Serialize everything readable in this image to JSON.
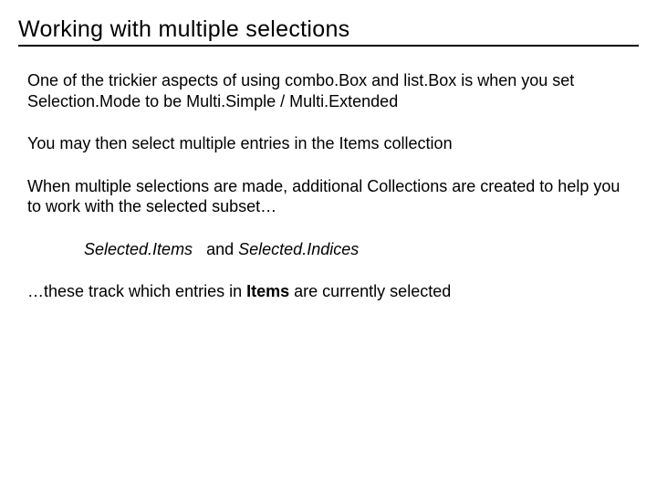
{
  "title": "Working with multiple selections",
  "p1": "One of the trickier aspects of using combo.Box and list.Box is when you set Selection.Mode to be Multi.Simple / Multi.Extended",
  "p2": "You may then select multiple entries in the Items collection",
  "p3": "When multiple selections are made, additional Collections are created to help you to work with the selected subset…",
  "p4a": "Selected.Items",
  "p4b": "and",
  "p4c": "Selected.Indices",
  "p5a": "…these track which entries in ",
  "p5b": "Items",
  "p5c": " are currently selected"
}
